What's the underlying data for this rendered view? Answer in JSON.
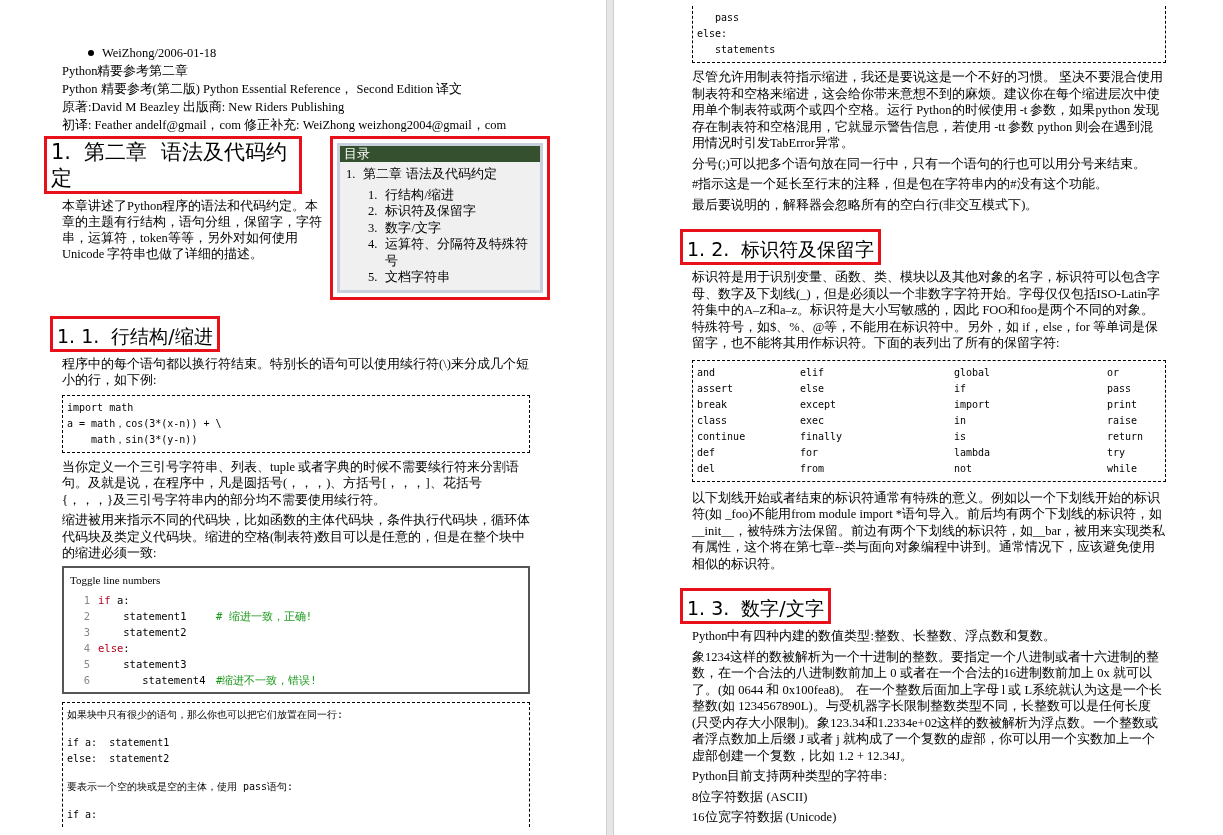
{
  "left_page": {
    "blocks": [
      {
        "kind": "meta",
        "bulleted": true,
        "text": "WeiZhong/2006-01-18"
      },
      {
        "kind": "meta",
        "bulleted": false,
        "text": "Python精要参考第二章"
      },
      {
        "kind": "meta",
        "bulleted": false,
        "text": "Python 精要参考(第二版) Python Essential Reference，  Second Edition 译文"
      },
      {
        "kind": "meta",
        "bulleted": false,
        "text": "原著:David M Beazley 出版商: New Riders Publishing"
      },
      {
        "kind": "meta",
        "bulleted": false,
        "text": "初译: Feather andelf@gmail，com 修正补充: WeiZhong weizhong2004@gmail，com"
      },
      {
        "kind": "chapter",
        "heading": {
          "text": "1.  第二章  语法及代码约定",
          "highlighted": true
        },
        "intro": "本章讲述了Python程序的语法和代码约定。本章的主题有行结构，语句分组，保留字，字符串，运算符，token等等，另外对如何使用Unicode 字符串也做了详细的描述。",
        "toc": {
          "title": "目录",
          "highlighted": true,
          "items": [
            {
              "number": "1.",
              "text": "第二章 语法及代码约定",
              "children": [
                {
                  "number": "1.",
                  "text": "行结构/缩进"
                },
                {
                  "number": "2.",
                  "text": "标识符及保留字"
                },
                {
                  "number": "3.",
                  "text": "数字/文字"
                },
                {
                  "number": "4.",
                  "text": "运算符、分隔符及特殊符号"
                },
                {
                  "number": "5.",
                  "text": "文档字符串"
                }
              ]
            }
          ]
        }
      },
      {
        "kind": "heading",
        "text": "1. 1.  行结构/缩进",
        "highlighted": true
      },
      {
        "kind": "paragraph",
        "text": "程序中的每个语句都以换行符结束。特别长的语句可以使用续行符(\\)来分成几个短小的行，如下例:"
      },
      {
        "kind": "code",
        "groups": [
          [
            "import math",
            "a = math，cos(3*(x-n)) + \\",
            "    math，sin(3*(y-n))"
          ]
        ]
      },
      {
        "kind": "paragraph",
        "text": "当你定义一个三引号字符串、列表、tuple 或者字典的时候不需要续行符来分割语句。及就是说，在程序中，凡是圆括号(，，，)、方括号[，，，]、花括号{，，，}及三引号字符串内的部分均不需要使用续行符。"
      },
      {
        "kind": "paragraph",
        "text": "缩进被用来指示不同的代码块，比如函数的主体代码块，条件执行代码块，循环体代码块及类定义代码块。缩进的空格(制表符)数目可以是任意的，但是在整个块中的缩进必须一致:"
      },
      {
        "kind": "numbered_code",
        "title": "Toggle line numbers",
        "lines": [
          {
            "number": "1",
            "keyword": "if",
            "code": " a:"
          },
          {
            "number": "2",
            "code": "    statement1",
            "comment": "# 缩进一致，正确!"
          },
          {
            "number": "3",
            "code": "    statement2"
          },
          {
            "number": "4",
            "keyword": "else",
            "code": ":"
          },
          {
            "number": "5",
            "code": "    statement3"
          },
          {
            "number": "6",
            "code": "       statement4",
            "comment": "#缩进不一致，错误!"
          }
        ]
      },
      {
        "kind": "code",
        "continues": true,
        "groups": [
          [
            "如果块中只有很少的语句，那么你也可以把它们放置在同一行:"
          ],
          [
            "if a:  statement1",
            "else:  statement2"
          ],
          [
            "要表示一个空的块或是空的主体，使用 pass语句:"
          ],
          [
            "if a:"
          ]
        ]
      }
    ]
  },
  "right_page": {
    "blocks": [
      {
        "kind": "code",
        "continued": true,
        "groups": [
          [
            "   pass",
            "else:",
            "   statements"
          ]
        ]
      },
      {
        "kind": "paragraph",
        "text": "尽管允许用制表符指示缩进，我还是要说这是一个不好的习惯。 坚决不要混合使用制表符和空格来缩进，这会给你带来意想不到的麻烦。建议你在每个缩进层次中使用单个制表符或两个或四个空格。运行 Python的时候使用 -t 参数，如果python 发现存在制表符和空格混用，它就显示警告信息，若使用 -tt 参数 python 则会在遇到混用情况时引发TabError异常。"
      },
      {
        "kind": "paragraph",
        "text": "分号(;)可以把多个语句放在同一行中，只有一个语句的行也可以用分号来结束。"
      },
      {
        "kind": "paragraph",
        "text": "#指示这是一个延长至行末的注释，但是包在字符串内的#没有这个功能。"
      },
      {
        "kind": "paragraph",
        "text": "最后要说明的，解释器会忽略所有的空白行(非交互模式下)。"
      },
      {
        "kind": "heading",
        "text": "1. 2.  标识符及保留字",
        "highlighted": true
      },
      {
        "kind": "paragraph",
        "text": "标识符是用于识别变量、函数、类、模块以及其他对象的名字，标识符可以包含字母、数字及下划线(_)，但是必须以一个非数字字符开始。字母仅仅包括ISO-Latin字符集中的A–Z和a–z。标识符是大小写敏感的，因此 FOO和foo是两个不同的对象。特殊符号，如$、%、@等，不能用在标识符中。另外，如 if，else，for 等单词是保留字，也不能将其用作标识符。下面的表列出了所有的保留字符:"
      },
      {
        "kind": "keyword_table",
        "rows": [
          [
            "and",
            "elif",
            "global",
            "or"
          ],
          [
            "assert",
            "else",
            "if",
            "pass"
          ],
          [
            "break",
            "except",
            "import",
            "print"
          ],
          [
            "class",
            "exec",
            "in",
            "raise"
          ],
          [
            "continue",
            "finally",
            "is",
            "return"
          ],
          [
            "def",
            "for",
            "lambda",
            "try"
          ],
          [
            "del",
            "from",
            "not",
            "while"
          ]
        ]
      },
      {
        "kind": "paragraph",
        "text": "以下划线开始或者结束的标识符通常有特殊的意义。例如以一个下划线开始的标识符(如 _foo)不能用from module import *语句导入。前后均有两个下划线的标识符，如__init__，被特殊方法保留。前边有两个下划线的标识符，如__bar，被用来实现类私有属性，这个将在第七章--类与面向对象编程中讲到。通常情况下，应该避免使用相似的标识符。"
      },
      {
        "kind": "heading",
        "text": "1. 3.  数字/文字",
        "highlighted": true
      },
      {
        "kind": "paragraph",
        "text": "Python中有四种内建的数值类型:整数、长整数、浮点数和复数。"
      },
      {
        "kind": "paragraph",
        "text": "象1234这样的数被解析为一个十进制的整数。要指定一个八进制或者十六进制的整数，在一个合法的八进制数前加上 0 或者在一个合法的16进制数前加上 0x 就可以了。(如 0644 和 0x100fea8)。 在一个整数后面加上字母 l 或 L系统就认为这是一个长整数(如 1234567890L)。与受机器字长限制整数类型不同，长整数可以是任何长度(只受内存大小限制)。象123.34和1.2334e+02这样的数被解析为浮点数。一个整数或者浮点数加上后缀 J 或者 j 就构成了一个复数的虚部，你可以用一个实数加上一个虚部创建一个复数，比如 1.2 + 12.34J。"
      },
      {
        "kind": "paragraph",
        "text": "Python目前支持两种类型的字符串:"
      },
      {
        "kind": "paragraph",
        "text": "8位字符数据 (ASCII)"
      },
      {
        "kind": "paragraph",
        "text": "16位宽字符数据 (Unicode)"
      }
    ]
  }
}
